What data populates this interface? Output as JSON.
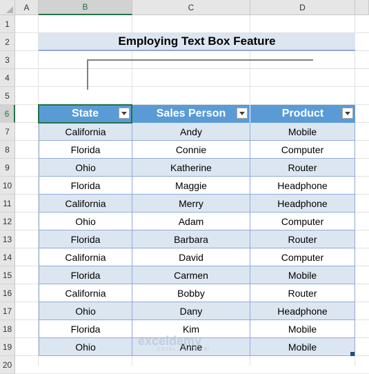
{
  "columns": [
    "A",
    "B",
    "C",
    "D"
  ],
  "rows": [
    "1",
    "2",
    "3",
    "4",
    "5",
    "6",
    "7",
    "8",
    "9",
    "10",
    "11",
    "12",
    "13",
    "14",
    "15",
    "16",
    "17",
    "18",
    "19",
    "20"
  ],
  "title": "Employing Text Box Feature",
  "table": {
    "headers": [
      "State",
      "Sales Person",
      "Product"
    ],
    "rows": [
      [
        "California",
        "Andy",
        "Mobile"
      ],
      [
        "Florida",
        "Connie",
        "Computer"
      ],
      [
        "Ohio",
        "Katherine",
        "Router"
      ],
      [
        "Florida",
        "Maggie",
        "Headphone"
      ],
      [
        "California",
        "Merry",
        "Headphone"
      ],
      [
        "Ohio",
        "Adam",
        "Computer"
      ],
      [
        "Florida",
        "Barbara",
        "Router"
      ],
      [
        "California",
        "David",
        "Computer"
      ],
      [
        "Florida",
        "Carmen",
        "Mobile"
      ],
      [
        "California",
        "Bobby",
        "Router"
      ],
      [
        "Ohio",
        "Dany",
        "Headphone"
      ],
      [
        "Florida",
        "Kim",
        "Mobile"
      ],
      [
        "Ohio",
        "Anne",
        "Mobile"
      ]
    ]
  },
  "watermark": {
    "brand": "exceldemy",
    "tagline": "EXCEL · DATA · BI"
  },
  "colors": {
    "header_fill": "#5b9bd5",
    "band_fill": "#dce6f1",
    "border": "#8ea9db",
    "selection": "#217346"
  }
}
